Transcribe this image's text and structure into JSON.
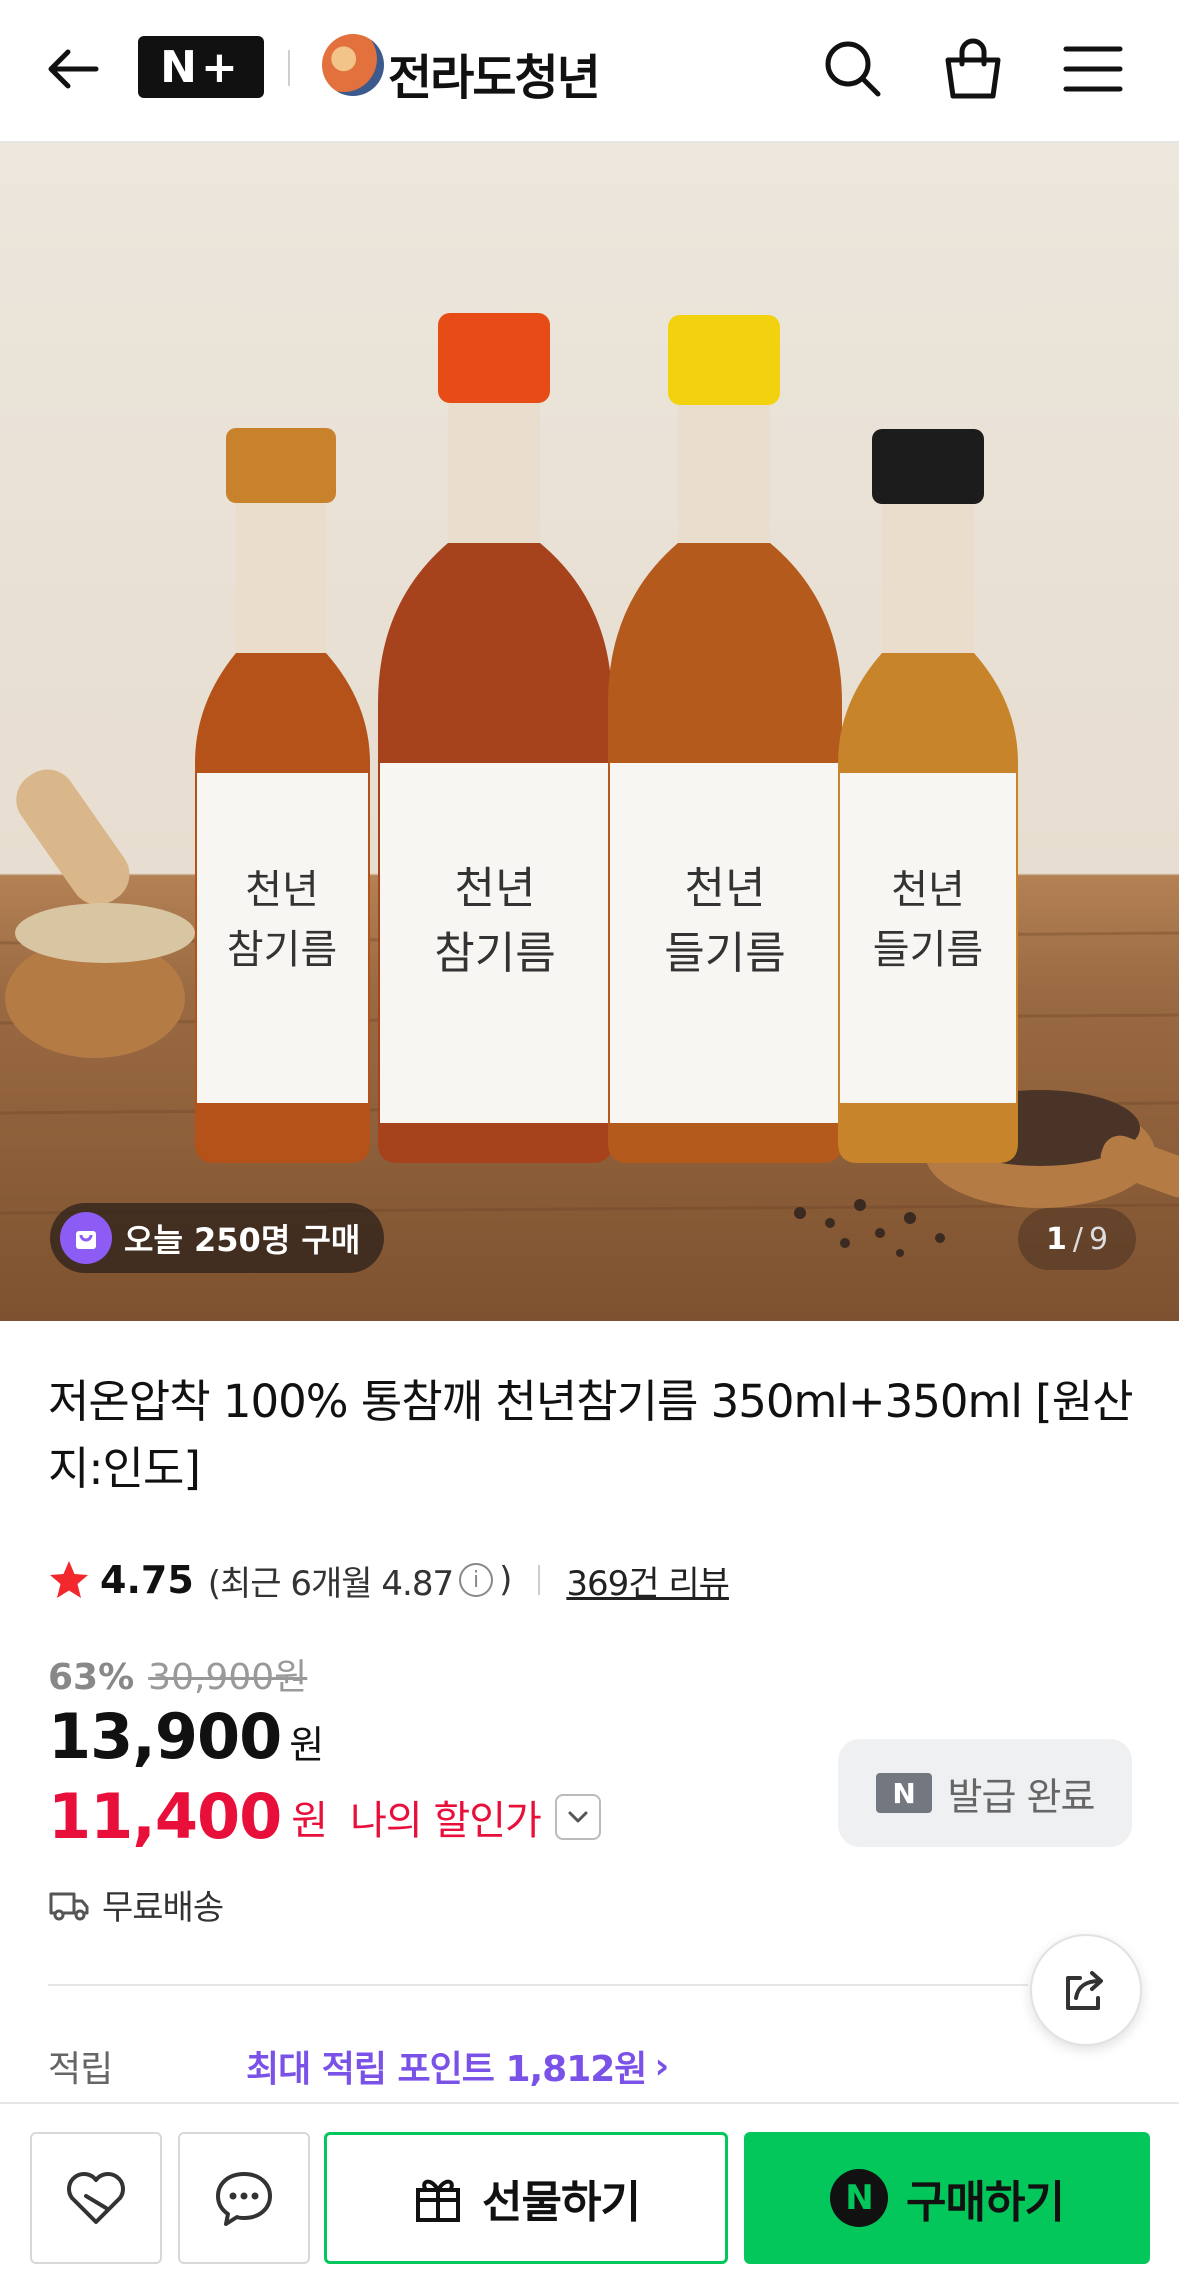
{
  "header": {
    "nplus_label": "N+",
    "store_name": "전라도청년"
  },
  "hero": {
    "today_badge": "오늘 250명 구매",
    "page_current": "1",
    "page_sep": "/",
    "page_total": "9"
  },
  "product": {
    "title": "저온압착 100% 통참깨 천년참기름 350ml+350ml [원산지:인도]",
    "rating": "4.75",
    "recent_rating": "(최근 6개월 4.87",
    "recent_close": ")",
    "review_count": "369건 리뷰",
    "discount_rate": "63%",
    "original_price": "30,900원",
    "price": "13,900",
    "price_unit": "원",
    "my_price": "11,400",
    "my_price_unit": "원",
    "my_price_label": "나의 할인가",
    "coupon_label": "발급 완료",
    "shipping": "무료배송",
    "points_label": "적립",
    "points_value": "최대 적립 포인트 1,812원",
    "points_chevron": "›"
  },
  "bottom_bar": {
    "gift_label": "선물하기",
    "buy_label": "구매하기"
  },
  "colors": {
    "accent_green": "#03c75a",
    "discount_red": "#e8103a",
    "points_purple": "#7b52e8"
  }
}
